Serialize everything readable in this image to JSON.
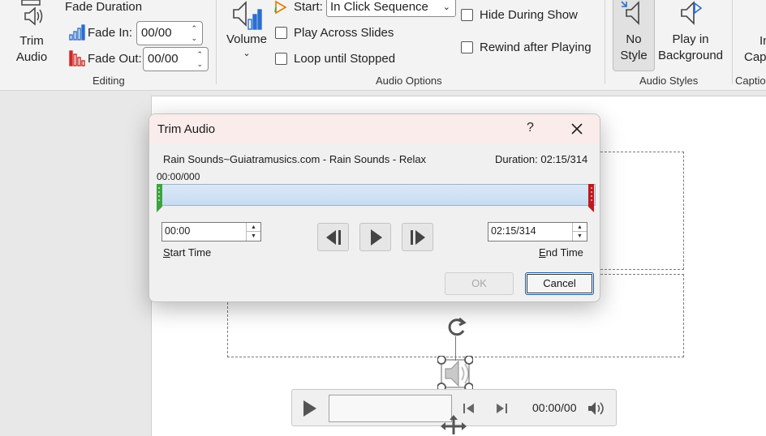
{
  "ribbon": {
    "trim_audio_label_1": "Trim",
    "trim_audio_label_2": "Audio",
    "fade_duration_label": "Fade Duration",
    "fade_in_label": "Fade In:",
    "fade_in_value": "00/00",
    "fade_out_label": "Fade Out:",
    "fade_out_value": "00/00",
    "editing_group": "Editing",
    "volume_label": "Volume",
    "start_label": "Start:",
    "start_value": "In Click Sequence",
    "play_across_slides": "Play Across Slides",
    "loop_until_stopped": "Loop until Stopped",
    "hide_during_show": "Hide During Show",
    "rewind_after_playing": "Rewind after Playing",
    "audio_options_group": "Audio Options",
    "no_style_1": "No",
    "no_style_2": "Style",
    "play_bg_1": "Play in",
    "play_bg_2": "Background",
    "audio_styles_group": "Audio Styles",
    "caption_1": "In",
    "caption_2": "Cap",
    "captions_group": "Captio"
  },
  "dialog": {
    "title": "Trim Audio",
    "help": "?",
    "track_name": "Rain Sounds~Guiatramusics.com - Rain Sounds - Relax",
    "duration": "Duration: 02:15/314",
    "position": "00:00/000",
    "start_time_value": "00:00",
    "start_time_label_accel": "S",
    "start_time_label_rest": "tart Time",
    "end_time_value": "02:15/314",
    "end_time_label_accel": "E",
    "end_time_label_rest": "nd Time",
    "ok": "OK",
    "cancel": "Cancel"
  },
  "player": {
    "time": "00:00/00"
  },
  "colors": {
    "start_marker": "#3ca33c",
    "end_marker": "#c0181c",
    "accent_blue": "#1c5fa8"
  }
}
